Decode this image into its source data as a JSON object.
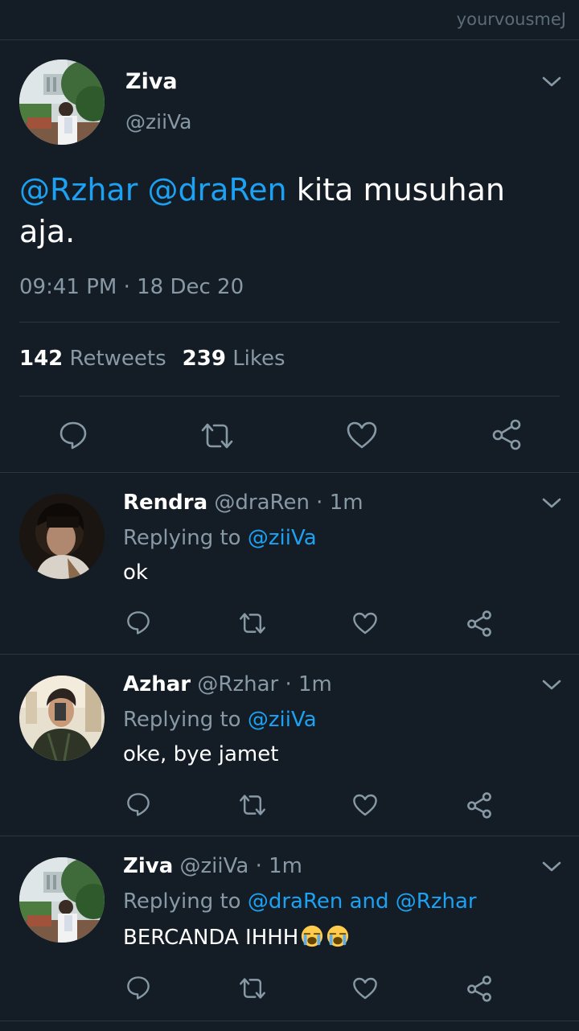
{
  "watermark": "yourvousmeJ",
  "main_tweet": {
    "name": "Ziva",
    "handle": "@ziiVa",
    "mention1": "@Rzhar",
    "mention2": "@draRen",
    "text": " kita musuhan aja.",
    "timestamp": "09:41 PM · 18 Dec 20",
    "retweets_count": "142",
    "retweets_label": "Retweets",
    "likes_count": "239",
    "likes_label": "Likes",
    "actions": [
      "reply-icon",
      "retweet-icon",
      "like-icon",
      "share-icon"
    ]
  },
  "replies": [
    {
      "name": "Rendra",
      "meta": "@draRen · 1m",
      "replying_prefix": "Replying to ",
      "replying_to": "@ziiVa",
      "text": "ok"
    },
    {
      "name": "Azhar",
      "meta": "@Rzhar · 1m",
      "replying_prefix": "Replying to ",
      "replying_to": "@ziiVa",
      "text": "oke, bye jamet"
    },
    {
      "name": "Ziva",
      "meta": "@ziiVa · 1m",
      "replying_prefix": "Replying to ",
      "replying_to": "@draRen and @Rzhar",
      "text": "BERCANDA IHHH",
      "emojis": [
        "loudly-crying-face",
        "loudly-crying-face"
      ]
    }
  ],
  "colors": {
    "background": "#141d26",
    "link": "#1da1f2",
    "muted": "#8899a6",
    "divider": "#2b3640"
  }
}
